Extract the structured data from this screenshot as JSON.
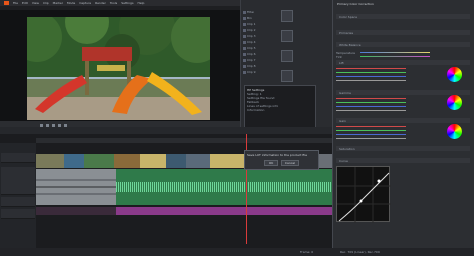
{
  "menu": {
    "items": [
      "File",
      "Edit",
      "View",
      "Clip",
      "Marker",
      "Mode",
      "Capture",
      "Render",
      "Tools",
      "Settings",
      "Help"
    ]
  },
  "browser": {
    "items": [
      "Filter",
      "Bin",
      "Clip 1",
      "Clip 2",
      "Clip 3",
      "Clip 4",
      "Clip 5",
      "Clip 6",
      "Clip 7",
      "Clip 8",
      "Clip 9",
      "Clip 10",
      "Clip 11",
      "Clip 12"
    ]
  },
  "info_dialog": {
    "title": "HP Settings",
    "lines": [
      "Setting: 1",
      "Settings file found",
      "Fallback",
      "Lines of settings info",
      "Information"
    ],
    "ok_label": "OK"
  },
  "message": {
    "text": "Save LUT information to the product file",
    "ok_label": "OK",
    "cancel_label": "Cancel"
  },
  "effects": {
    "title": "Primary Color Correction",
    "rows": [
      "Color Space",
      "Primaries",
      "Gamma",
      "White Balance",
      "Temperature",
      "Tint",
      "Lift",
      "Gamma",
      "Gain",
      "Offset",
      "Saturation"
    ],
    "section_color_balance": "Color Balance",
    "section_curve": "Curve"
  },
  "status": {
    "text": "Rec. 709 (Linear), Rec.709",
    "frame": "Frame: 0"
  }
}
